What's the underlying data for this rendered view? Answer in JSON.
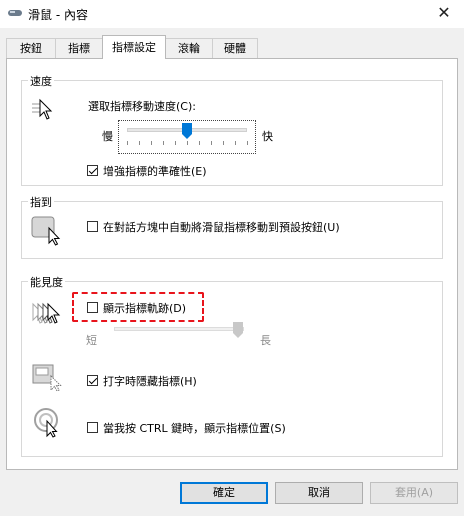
{
  "window": {
    "title": "滑鼠 - 內容",
    "close_glyph": "✕"
  },
  "tabs": [
    {
      "label": "按鈕"
    },
    {
      "label": "指標"
    },
    {
      "label": "指標設定"
    },
    {
      "label": "滾輪"
    },
    {
      "label": "硬體"
    }
  ],
  "motion": {
    "group_label": "速度",
    "speed_label": "選取指標移動速度(C):",
    "slow_label": "慢",
    "fast_label": "快",
    "speed_fraction": 0.5,
    "precision_label": "增強指標的準確性(E)",
    "precision_checked": true
  },
  "snapto": {
    "group_label": "指到",
    "label": "在對話方塊中自動將滑鼠指標移動到預設按鈕(U)",
    "checked": false
  },
  "visibility": {
    "group_label": "能見度",
    "trails_label": "顯示指標軌跡(D)",
    "trails_checked": false,
    "short_label": "短",
    "long_label": "長",
    "trails_fraction": 1.0,
    "hide_typing_label": "打字時隱藏指標(H)",
    "hide_typing_checked": true,
    "ctrl_label": "當我按 CTRL 鍵時，顯示指標位置(S)",
    "ctrl_checked": false
  },
  "buttons": {
    "ok": "確定",
    "cancel": "取消",
    "apply": "套用(A)"
  },
  "colors": {
    "highlight_box": "#e8141c",
    "accent": "#0078d7"
  }
}
